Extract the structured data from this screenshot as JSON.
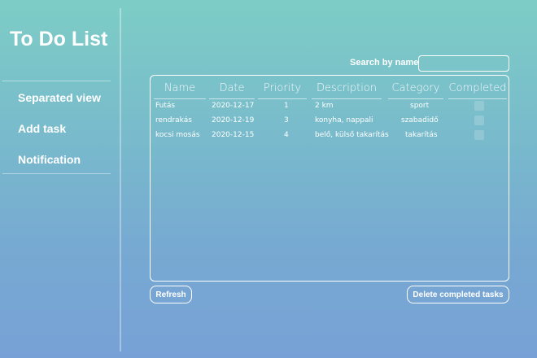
{
  "app": {
    "title": "To Do List"
  },
  "sidebar": {
    "items": [
      {
        "label": "Separated view"
      },
      {
        "label": "Add task"
      },
      {
        "label": "Notification"
      }
    ]
  },
  "search": {
    "label": "Search by name",
    "value": "",
    "placeholder": ""
  },
  "table": {
    "columns": [
      "Name",
      "Date",
      "Priority",
      "Description",
      "Category",
      "Completed"
    ],
    "rows": [
      {
        "name": "Futás",
        "date": "2020-12-17",
        "priority": "1",
        "description": "2 km",
        "category": "sport",
        "completed": false
      },
      {
        "name": "rendrakás",
        "date": "2020-12-19",
        "priority": "3",
        "description": "konyha, nappali",
        "category": "szabadidő",
        "completed": false
      },
      {
        "name": "kocsi mosás",
        "date": "2020-12-15",
        "priority": "4",
        "description": "belő, külső takarítás",
        "category": "takarítás",
        "completed": false
      }
    ]
  },
  "buttons": {
    "refresh": "Refresh",
    "delete_completed": "Delete completed tasks"
  }
}
